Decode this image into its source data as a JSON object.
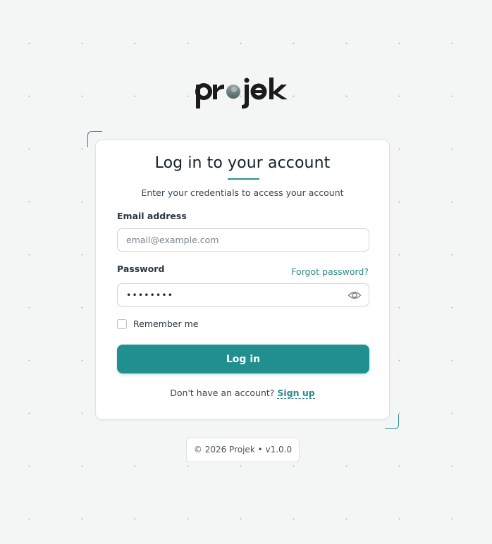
{
  "brand": {
    "logo_text": "projek",
    "logo_icon": "projek-logo",
    "accent_color": "#218f8f"
  },
  "card": {
    "title": "Log in to your account",
    "subtitle": "Enter your credentials to access your account",
    "email_label": "Email address",
    "email_placeholder": "email@example.com",
    "email_value": "",
    "password_label": "Password",
    "forgot_label": "Forgot password?",
    "password_value": "••••••••",
    "password_toggle_icon": "eye-icon",
    "remember_label": "Remember me",
    "remember_checked": false,
    "login_label": "Log in",
    "signup_prompt": "Don't have an account?",
    "signup_label": "Sign up"
  },
  "footer": {
    "text": "© 2026 Projek • v1.0.0"
  }
}
